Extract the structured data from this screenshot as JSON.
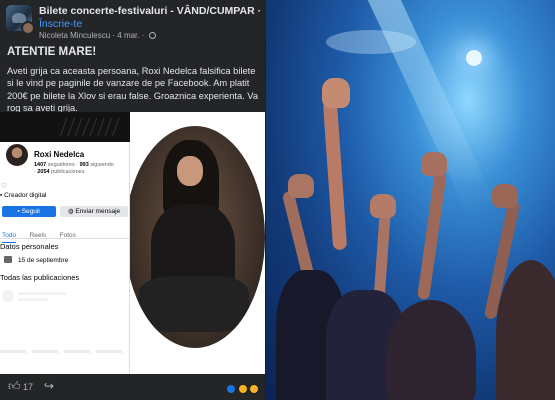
{
  "post": {
    "group_name": "Bilete concerte-festivaluri - VÂND/CUMPAR ·",
    "join_label": "Înscrie-te",
    "author": "Nicoleta Minculescu",
    "date": "4 mar.",
    "title": "ATENTIE MARE!",
    "body": "Aveti grija ca aceasta persoana, Roxi Nedelca falsifica bilete si le vind pe paginile de vanzare de pe Facebook. Am platit 200€ pe bilete la Xlov si erau false. Groaznica experienta. Va rog sa aveti grija."
  },
  "profile": {
    "name": "Roxi Nedelca",
    "followers": "1407",
    "followers_label": "seguidores ·",
    "following": "993",
    "following_label": "siguiendo",
    "posts": "2054",
    "posts_label": "publicaciones",
    "creator_label": "Creador digital",
    "follow_label": "Seguir",
    "message_label": "Enviar mensaje",
    "tabs": [
      {
        "label": "Todo",
        "active": true
      },
      {
        "label": "Reels",
        "active": false
      },
      {
        "label": "Fotos",
        "active": false
      }
    ],
    "personal_title": "Datos personales",
    "birthday": "15 de septiembre",
    "all_posts_title": "Todas las publicaciones"
  },
  "reactions": {
    "like_count": "17"
  },
  "icons": {
    "like": "thumbs-up-icon",
    "share": "share-icon",
    "globe": "globe-icon",
    "cake": "cake-icon"
  },
  "colors": {
    "facebook_blue": "#1b74e4",
    "link_blue": "#4599ff",
    "dark_bg": "#242526"
  }
}
